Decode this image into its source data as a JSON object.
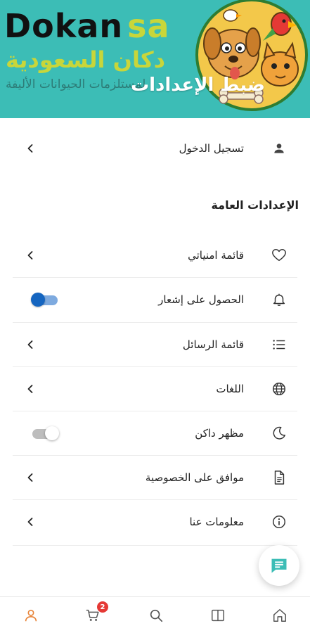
{
  "header": {
    "brand_latin_1": "Dokan",
    "brand_latin_2": "sa",
    "brand_arabic": "دكان السعودية",
    "tagline": "لمستلزمات الحيوانات الأليفة",
    "title": "ضبط الإعدادات"
  },
  "login": {
    "label": "تسجيل الدخول",
    "icon": "person-icon"
  },
  "general_settings": {
    "title": "الإعدادات العامة",
    "items": [
      {
        "label": "قائمة امنياتي",
        "icon": "heart-icon",
        "control": "chevron"
      },
      {
        "label": "الحصول على إشعار",
        "icon": "bell-icon",
        "control": "toggle",
        "enabled": true
      },
      {
        "label": "قائمة الرسائل",
        "icon": "list-icon",
        "control": "chevron"
      },
      {
        "label": "اللغات",
        "icon": "globe-icon",
        "control": "chevron"
      },
      {
        "label": "مظهر داكن",
        "icon": "moon-icon",
        "control": "toggle",
        "enabled": false
      },
      {
        "label": "موافق على الخصوصية",
        "icon": "document-icon",
        "control": "chevron"
      },
      {
        "label": "معلومات عنا",
        "icon": "info-icon",
        "control": "chevron"
      }
    ]
  },
  "bottom_nav": {
    "cart_badge": "2",
    "items": [
      "home-icon",
      "book-icon",
      "search-icon",
      "cart-icon",
      "profile-icon"
    ],
    "active": "profile-icon"
  },
  "colors": {
    "header_bg": "#3cbdb6",
    "brand_green": "#c8d63a",
    "accent_blue": "#1565c0",
    "active_nav": "#e8853a",
    "badge_red": "#e53935"
  }
}
